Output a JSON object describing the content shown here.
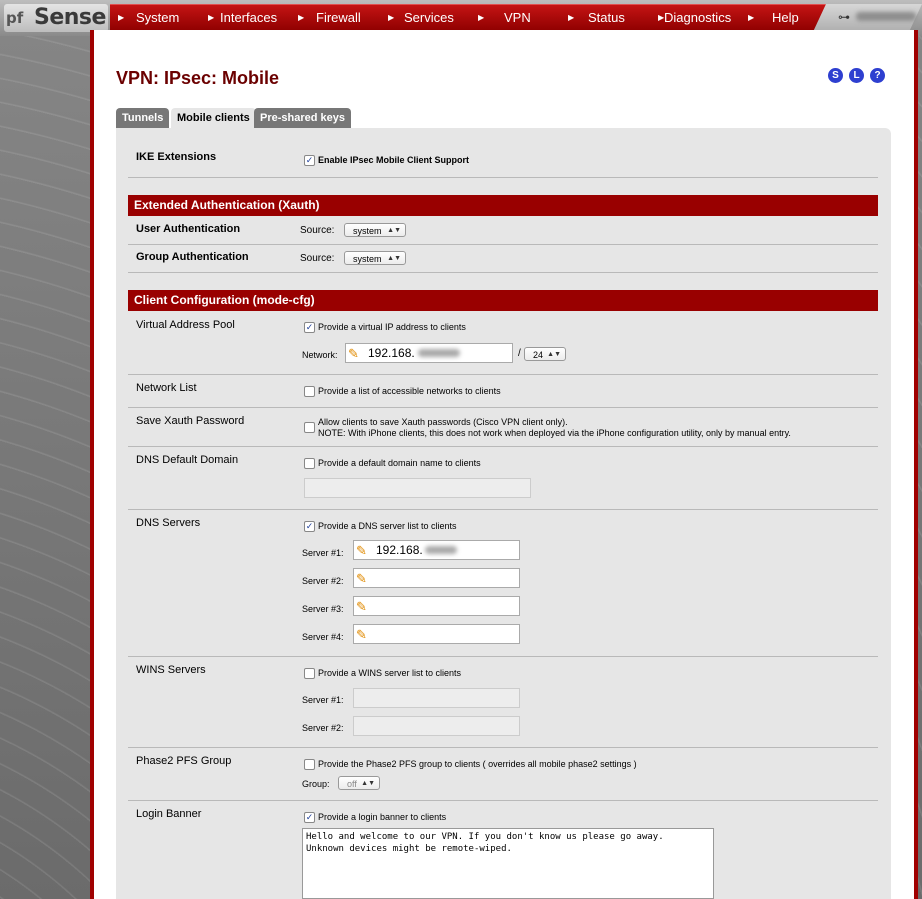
{
  "nav": {
    "logo_text": "Sense",
    "logo_prefix": "pf",
    "items": [
      "System",
      "Interfaces",
      "Firewall",
      "Services",
      "VPN",
      "Status",
      "Diagnostics",
      "Help"
    ]
  },
  "page": {
    "title": "VPN: IPsec: Mobile",
    "help_icons": [
      "S",
      "L",
      "?"
    ]
  },
  "tabs": [
    {
      "label": "Tunnels",
      "active": false
    },
    {
      "label": "Mobile clients",
      "active": true
    },
    {
      "label": "Pre-shared keys",
      "active": false
    }
  ],
  "ike": {
    "label": "IKE Extensions",
    "checkbox_label": "Enable IPsec Mobile Client Support",
    "checked": true
  },
  "xauth": {
    "header": "Extended Authentication (Xauth)",
    "user_label": "User Authentication",
    "group_label": "Group Authentication",
    "source_label": "Source:",
    "user_source": "system",
    "group_source": "system"
  },
  "modecfg": {
    "header": "Client Configuration (mode-cfg)",
    "vap": {
      "label": "Virtual Address Pool",
      "checkbox_label": "Provide a virtual IP address to clients",
      "checked": true,
      "network_label": "Network:",
      "network_value": "192.168.",
      "mask": "24"
    },
    "netlist": {
      "label": "Network List",
      "checkbox_label": "Provide a list of accessible networks to clients",
      "checked": false
    },
    "xauthpw": {
      "label": "Save Xauth Password",
      "checkbox_label": "Allow clients to save Xauth passwords (Cisco VPN client only).",
      "note": "NOTE: With iPhone clients, this does not work when deployed via the iPhone configuration utility, only by manual entry.",
      "checked": false
    },
    "dnsdomain": {
      "label": "DNS Default Domain",
      "checkbox_label": "Provide a default domain name to clients",
      "checked": false,
      "value": ""
    },
    "dns": {
      "label": "DNS Servers",
      "checkbox_label": "Provide a DNS server list to clients",
      "checked": true,
      "servers": [
        {
          "label": "Server #1:",
          "value": "192.168."
        },
        {
          "label": "Server #2:",
          "value": ""
        },
        {
          "label": "Server #3:",
          "value": ""
        },
        {
          "label": "Server #4:",
          "value": ""
        }
      ]
    },
    "wins": {
      "label": "WINS Servers",
      "checkbox_label": "Provide a WINS server list to clients",
      "checked": false,
      "servers": [
        {
          "label": "Server #1:",
          "value": ""
        },
        {
          "label": "Server #2:",
          "value": ""
        }
      ]
    },
    "pfs": {
      "label": "Phase2 PFS Group",
      "checkbox_label": "Provide the Phase2 PFS group to clients ( overrides all mobile phase2 settings )",
      "checked": false,
      "group_label": "Group:",
      "group_value": "off"
    },
    "banner": {
      "label": "Login Banner",
      "checkbox_label": "Provide a login banner to clients",
      "checked": true,
      "text": "Hello and welcome to our VPN. If you don't know us please go away.\nUnknown devices might be remote-wiped."
    }
  }
}
